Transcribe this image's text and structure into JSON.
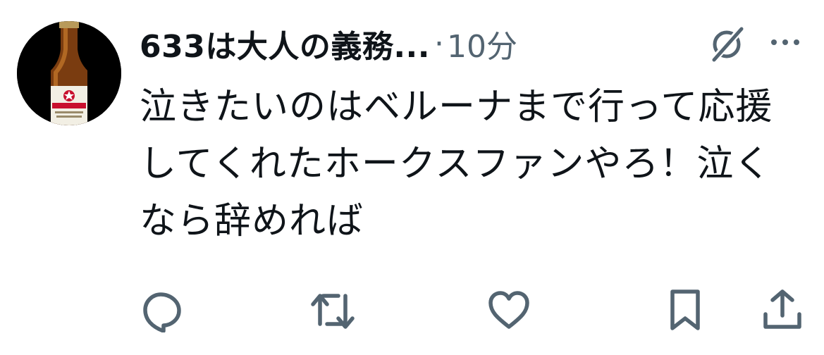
{
  "author": {
    "display_name": "633は大人の義務...",
    "separator": "·",
    "timestamp": "10分",
    "avatar_icon": "beer-bottle-avatar"
  },
  "tweet": {
    "text": "泣きたいのはベルーナまで行って応援してくれたホークスファンやろ！泣くなら辞めれば"
  },
  "header_icons": [
    "grok-icon",
    "more-icon"
  ],
  "actions": [
    "reply-icon",
    "retweet-icon",
    "like-icon",
    "bookmark-icon",
    "share-icon"
  ],
  "colors": {
    "text_primary": "#0f1419",
    "text_secondary": "#536471",
    "icon": "#536471",
    "background": "#ffffff"
  }
}
